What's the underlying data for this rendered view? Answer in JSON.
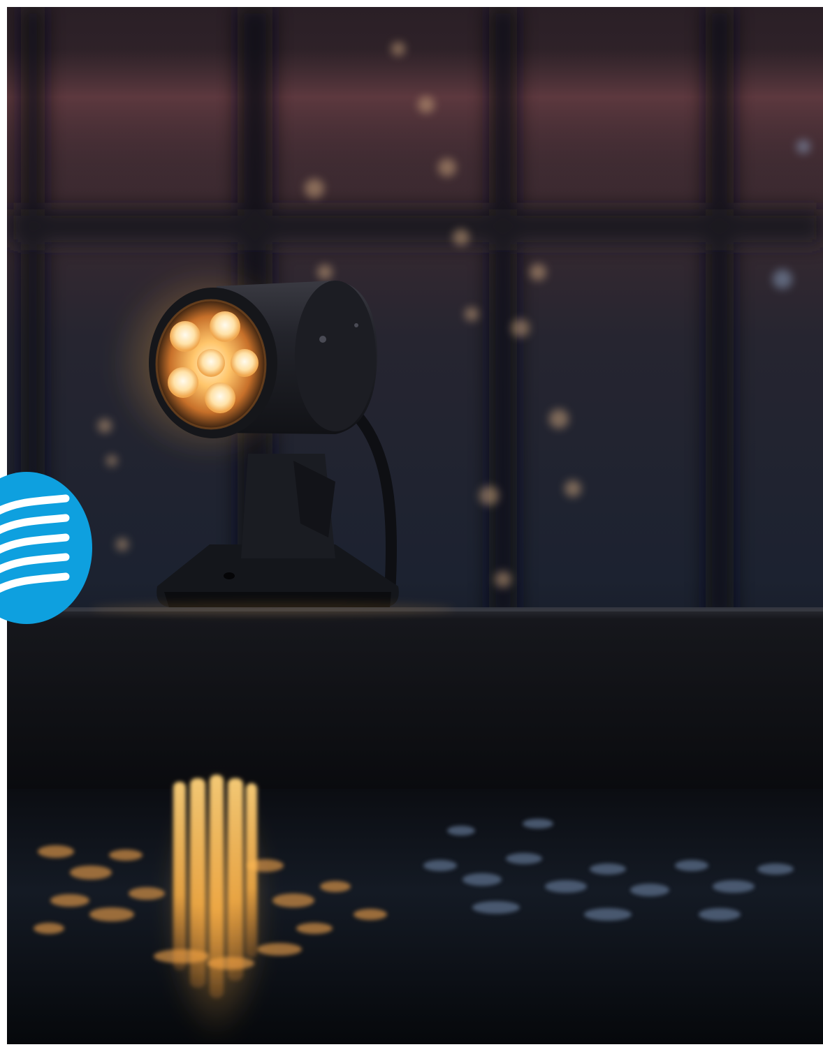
{
  "image": {
    "subject": "garden-spotlight",
    "setting": "fountain-pool-at-dusk",
    "light_color": "#ffb347",
    "housing_color": "#1b1e24",
    "led_count": 6
  },
  "badge": {
    "icon": "water-waves-icon",
    "color": "#0ea0df",
    "wave_color": "#ffffff"
  }
}
